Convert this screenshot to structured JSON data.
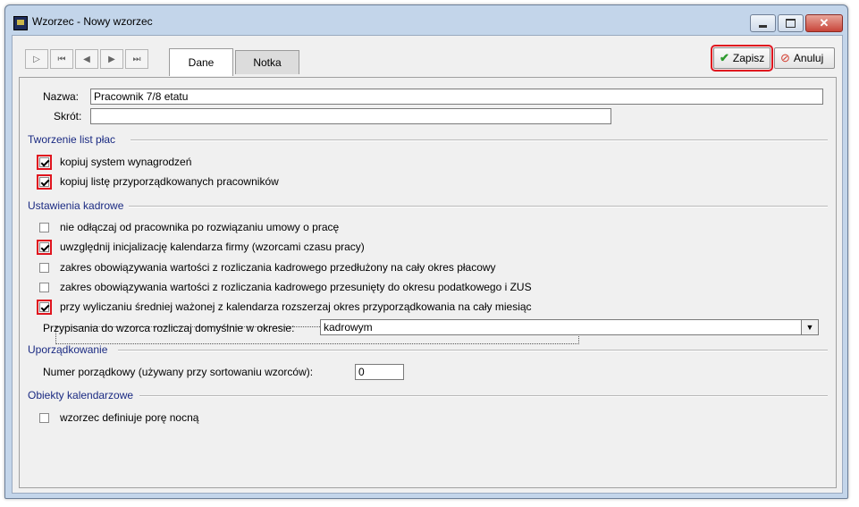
{
  "window": {
    "title": "Wzorzec - Nowy wzorzec"
  },
  "nav": {
    "first": "⏮",
    "prev_page": "◀◀",
    "prev": "◀",
    "next": "▶",
    "last": "⏭"
  },
  "tabs": [
    {
      "label": "Dane",
      "active": true
    },
    {
      "label": "Notka",
      "active": false
    }
  ],
  "toolbar": {
    "save_label": "Zapisz",
    "cancel_label": "Anuluj"
  },
  "form": {
    "name_label": "Nazwa:",
    "name_value": "Pracownik 7/8 etatu",
    "short_label": "Skrót:",
    "short_value": ""
  },
  "sections": {
    "payroll": "Tworzenie list płac",
    "hr": "Ustawienia kadrowe",
    "ordering": "Uporządkowanie",
    "calendar": "Obiekty kalendarzowe"
  },
  "payroll_options": [
    {
      "label": "kopiuj system wynagrodzeń",
      "checked": true
    },
    {
      "label": "kopiuj listę przyporządkowanych pracowników",
      "checked": true
    }
  ],
  "hr_options": [
    {
      "label": "nie odłączaj od pracownika po rozwiązaniu umowy o pracę",
      "checked": false
    },
    {
      "label": "uwzględnij inicjalizację kalendarza firmy (wzorcami czasu pracy)",
      "checked": true
    },
    {
      "label": "zakres obowiązywania wartości z rozliczania kadrowego przedłużony na cały okres płacowy",
      "checked": false
    },
    {
      "label": "zakres obowiązywania wartości z rozliczania kadrowego przesunięty do okresu podatkowego i ZUS",
      "checked": false
    },
    {
      "label": "przy wyliczaniu średniej ważonej z kalendarza rozszerzaj okres przyporządkowania na cały miesiąc",
      "checked": true
    }
  ],
  "assignment": {
    "label": "Przypisania do wzorca rozliczaj domyślnie w okresie:",
    "value": "kadrowym"
  },
  "ordering": {
    "label": "Numer porządkowy (używany przy sortowaniu wzorców):",
    "value": "0"
  },
  "calendar_options": [
    {
      "label": "wzorzec definiuje porę nocną",
      "checked": false
    }
  ],
  "colors": {
    "highlight": "#e0141e",
    "section_text": "#1a2a82",
    "save_icon": "#2e9b2e",
    "cancel_icon": "#d33a2c"
  }
}
